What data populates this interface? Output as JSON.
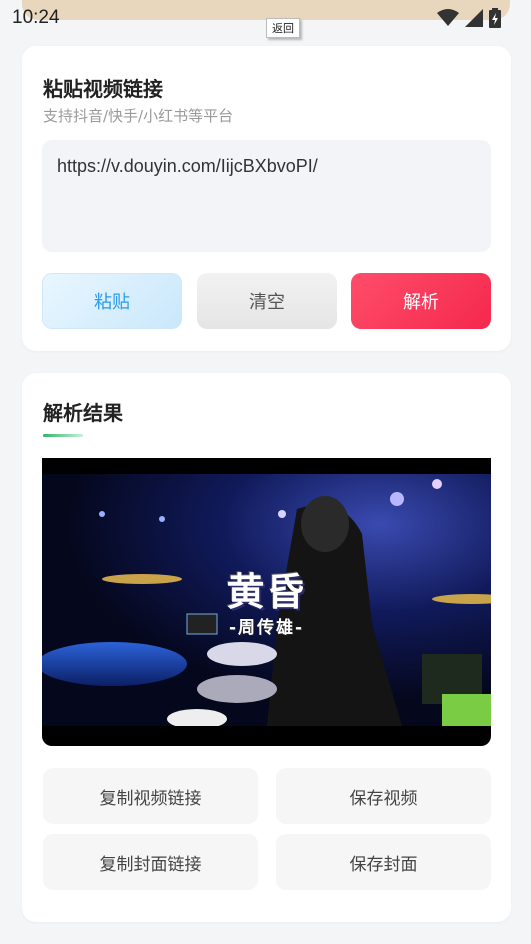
{
  "status_bar": {
    "time": "10:24"
  },
  "tooltip": {
    "text": "返回"
  },
  "input_card": {
    "title": "粘贴视频链接",
    "subtitle": "支持抖音/快手/小红书等平台",
    "url_value": "https://v.douyin.com/IijcBXbvoPI/",
    "buttons": {
      "paste": "粘贴",
      "clear": "清空",
      "parse": "解析"
    }
  },
  "result_card": {
    "title": "解析结果",
    "video": {
      "title": "黄昏",
      "subtitle": "-周传雄-"
    },
    "actions": {
      "copy_video_link": "复制视频链接",
      "save_video": "保存视频",
      "copy_cover_link": "复制封面链接",
      "save_cover": "保存封面"
    }
  },
  "colors": {
    "accent_blue": "#2b9bea",
    "accent_red": "#f4284d",
    "accent_green": "#2fb56a"
  },
  "icons": [
    "wifi-icon",
    "signal-icon",
    "battery-icon"
  ]
}
